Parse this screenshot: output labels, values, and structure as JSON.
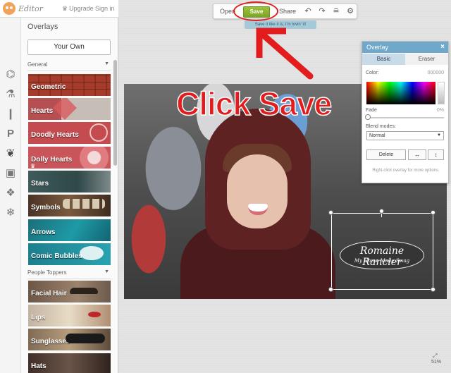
{
  "header": {
    "logo_text": "Editor",
    "upgrade_label": "Upgrade",
    "signin_label": "Sign in"
  },
  "rail": {
    "icons": [
      "flow-icon",
      "flask-icon",
      "brush-icon",
      "text-p-icon",
      "overlays-icon",
      "frame-icon",
      "texture-icon",
      "snowflake-icon"
    ]
  },
  "panel": {
    "title": "Overlays",
    "your_own_label": "Your Own",
    "sections": [
      {
        "label": "General",
        "items": [
          "Geometric",
          "Hearts",
          "Doodly Hearts",
          "Dolly Hearts",
          "Stars",
          "Symbols",
          "Arrows",
          "Comic Bubbles"
        ]
      },
      {
        "label": "People Toppers",
        "items": [
          "Facial Hair",
          "Lips",
          "Sunglasses",
          "Hats"
        ]
      }
    ]
  },
  "toolbar": {
    "open_label": "Open",
    "save_label": "Save",
    "share_label": "Share",
    "tooltip": "Save it like it is; I'm lovin' it!"
  },
  "annotation": {
    "text": "Click Save",
    "color": "#e31d1d"
  },
  "overlay_graphic": {
    "name": "Romaine Rancier",
    "tagline": "My Home Made Swag"
  },
  "dialog": {
    "title": "Overlay",
    "close_label": "×",
    "tabs": [
      "Basic",
      "Eraser"
    ],
    "color_label": "Color:",
    "color_value": "000000",
    "fade_label": "Fade",
    "fade_value": "0%",
    "blend_label": "Blend modes:",
    "blend_value": "Normal",
    "delete_label": "Delete",
    "flip_h_label": "↔",
    "flip_v_label": "↕",
    "hint": "Right-click overlay for more options."
  },
  "zoom": {
    "value": "51%"
  },
  "colors": {
    "save_button": "#8bb132",
    "dialog_header": "#6fa8c8",
    "annotation_red": "#e31d1d"
  }
}
